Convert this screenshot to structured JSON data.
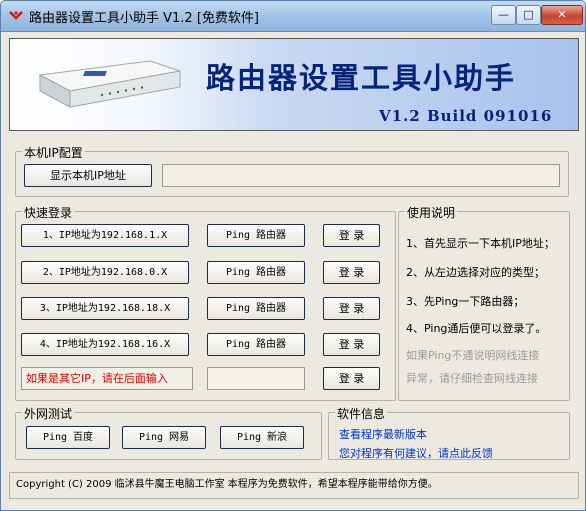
{
  "window": {
    "title": "路由器设置工具小助手 V1.2 [免费软件]",
    "minimize": "—",
    "maximize": "□",
    "close": "✕"
  },
  "banner": {
    "title": "路由器设置工具小助手",
    "version": "V1.2 Build 091016"
  },
  "local_ip": {
    "legend": "本机IP配置",
    "show_button": "显示本机IP地址",
    "ip_value": ""
  },
  "quick_login": {
    "legend": "快速登录",
    "rows": [
      {
        "address": "1、IP地址为192.168.1.X",
        "ping": "Ping 路由器",
        "login": "登 录"
      },
      {
        "address": "2、IP地址为192.168.0.X",
        "ping": "Ping 路由器",
        "login": "登 录"
      },
      {
        "address": "3、IP地址为192.168.18.X",
        "ping": "Ping 路由器",
        "login": "登 录"
      },
      {
        "address": "4、IP地址为192.168.16.X",
        "ping": "Ping 路由器",
        "login": "登 录"
      }
    ],
    "custom_hint": "如果是其它IP，请在后面输入",
    "custom_value": "",
    "custom_login": "登 录"
  },
  "instructions": {
    "legend": "使用说明",
    "lines": [
      "1、首先显示一下本机IP地址；",
      "2、从左边选择对应的类型；",
      "3、先Ping一下路由器；",
      "4、Ping通后便可以登录了。"
    ],
    "warning": [
      "如果Ping不通说明网线连接",
      "异常，请仔细检查网线连接"
    ]
  },
  "wan_test": {
    "legend": "外网测试",
    "buttons": [
      "Ping 百度",
      "Ping 网易",
      "Ping 新浪"
    ]
  },
  "software_info": {
    "legend": "软件信息",
    "links": [
      "查看程序最新版本",
      "您对程序有何建议，请点此反馈"
    ]
  },
  "status": {
    "text": "Copyright (C) 2009 临沭县牛魔王电脑工作室  本程序为免费软件，希望本程序能带给你方便。"
  },
  "colors": {
    "banner_text": "#06237a",
    "link": "#0033cc",
    "warning": "#e00000",
    "hint_gray": "#9a9a9a"
  }
}
